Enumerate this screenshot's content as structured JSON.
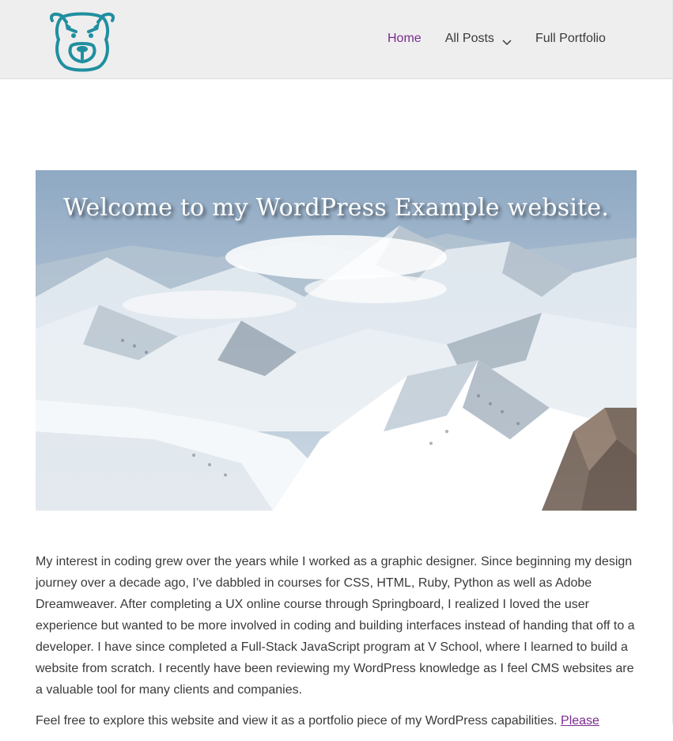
{
  "header": {
    "logo_icon": "bulldog-logo-icon",
    "nav": {
      "home_label": "Home",
      "all_posts_label": "All Posts",
      "full_portfolio_label": "Full Portfolio"
    }
  },
  "hero": {
    "title": "Welcome to my WordPress Example website."
  },
  "content": {
    "paragraph1": "My interest in coding grew over the years while I worked as a graphic designer. Since beginning my design journey over a decade ago, I’ve dabbled in courses for CSS, HTML, Ruby, Python as well as Adobe Dreamweaver. After completing a UX online course through Springboard, I realized I loved the user experience but wanted to be more involved in coding and building interfaces instead of handing that off to a developer. I have since completed a Full-Stack JavaScript program at V School, where I learned to build a website from scratch. I recently have been reviewing my WordPress knowledge as I feel CMS websites are a valuable tool for many clients and companies.",
    "paragraph2_text": "Feel free to explore this website and view it as a portfolio piece of my WordPress capabilities. ",
    "paragraph2_link": "Please"
  },
  "colors": {
    "accent": "#7b2b8f",
    "logo": "#1f8fa0",
    "header_bg": "#eeeeee"
  }
}
